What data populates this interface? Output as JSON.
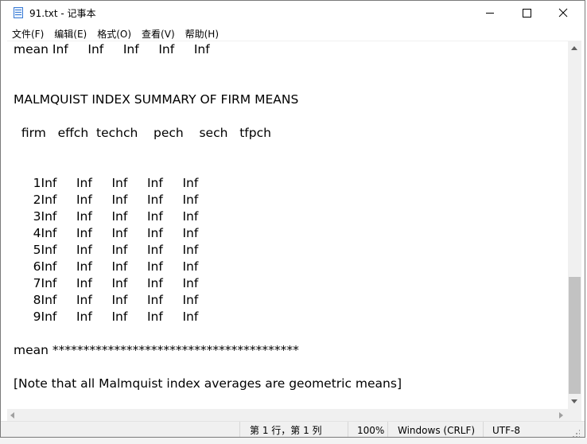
{
  "window": {
    "title": "91.txt - 记事本"
  },
  "menu": {
    "items": [
      "文件(F)",
      "编辑(E)",
      "格式(O)",
      "查看(V)",
      "帮助(H)"
    ]
  },
  "editor": {
    "lines": [
      "mean Inf     Inf     Inf     Inf     Inf",
      "",
      "",
      "MALMQUIST INDEX SUMMARY OF FIRM MEANS",
      "",
      "  firm   effch  techch    pech    sech   tfpch",
      "",
      "",
      "     1Inf     Inf     Inf     Inf     Inf",
      "     2Inf     Inf     Inf     Inf     Inf",
      "     3Inf     Inf     Inf     Inf     Inf",
      "     4Inf     Inf     Inf     Inf     Inf",
      "     5Inf     Inf     Inf     Inf     Inf",
      "     6Inf     Inf     Inf     Inf     Inf",
      "     7Inf     Inf     Inf     Inf     Inf",
      "     8Inf     Inf     Inf     Inf     Inf",
      "     9Inf     Inf     Inf     Inf     Inf",
      "",
      "mean ****************************************",
      "",
      "[Note that all Malmquist index averages are geometric means]"
    ]
  },
  "status": {
    "position": "第 1 行，第 1 列",
    "zoom": "100%",
    "eol": "Windows (CRLF)",
    "encoding": "UTF-8"
  },
  "icons": {
    "app": "notepad-icon",
    "minimize": "minimize-icon",
    "maximize": "maximize-icon",
    "close": "close-icon"
  }
}
